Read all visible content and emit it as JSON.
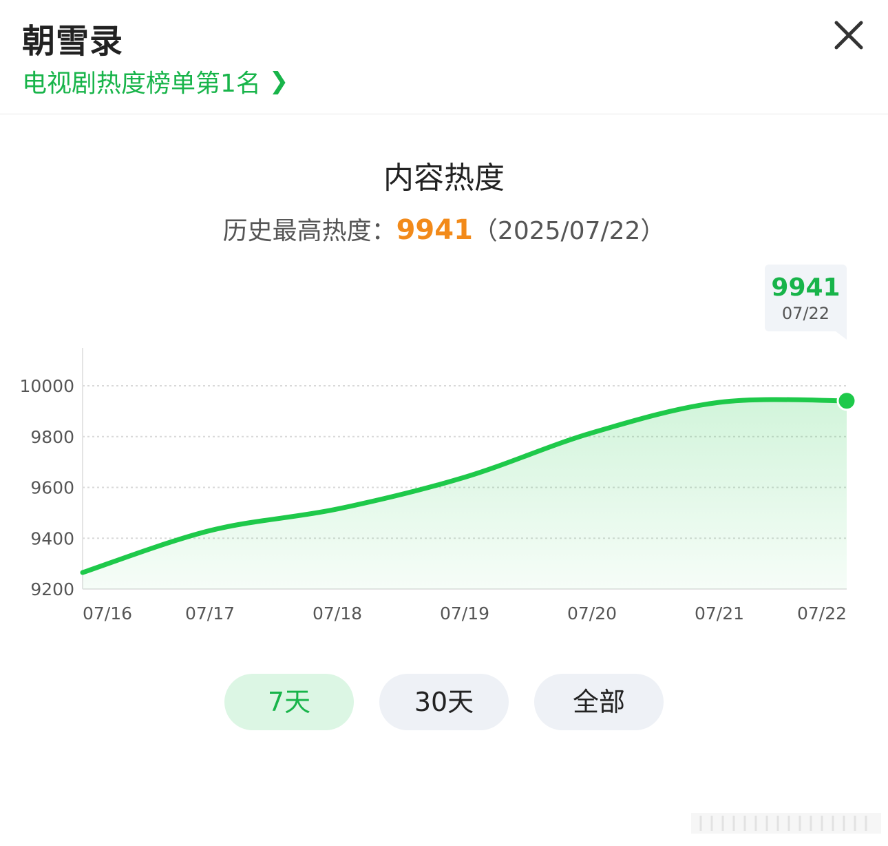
{
  "header": {
    "title": "朝雪录",
    "rank_link": "电视剧热度榜单第1名",
    "close_icon": "close-icon"
  },
  "summary": {
    "chart_title": "内容热度",
    "record_label": "历史最高热度：",
    "record_value": "9941",
    "record_date": "（2025/07/22）"
  },
  "tooltip": {
    "value": "9941",
    "date": "07/22"
  },
  "range_tabs": [
    {
      "label": "7天",
      "active": true
    },
    {
      "label": "30天",
      "active": false
    },
    {
      "label": "全部",
      "active": false
    }
  ],
  "colors": {
    "accent": "#18b44a",
    "line": "#1ec94a",
    "record": "#f28a1a",
    "grid": "#d9d9d9"
  },
  "chart_data": {
    "type": "area",
    "categories": [
      "07/16",
      "07/17",
      "07/18",
      "07/19",
      "07/20",
      "07/21",
      "07/22"
    ],
    "values": [
      9265,
      9430,
      9515,
      9640,
      9815,
      9935,
      9941
    ],
    "ylim": [
      9200,
      10000
    ],
    "yticks": [
      9200,
      9400,
      9600,
      9800,
      10000
    ],
    "grid": true,
    "highlight_index": 6
  }
}
